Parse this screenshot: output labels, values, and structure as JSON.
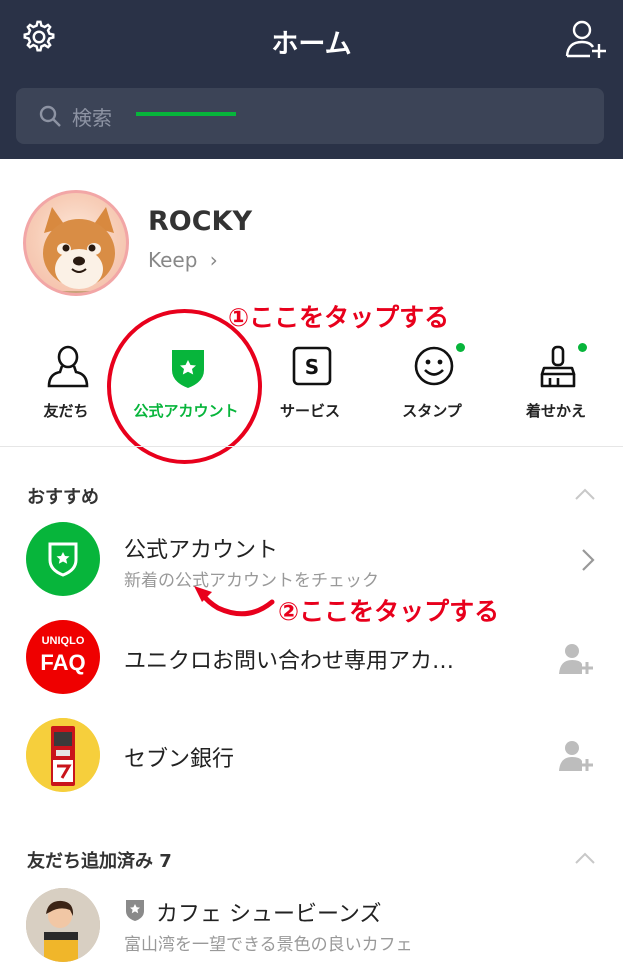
{
  "header": {
    "title": "ホーム",
    "search_placeholder": "検索",
    "icons": [
      "gear-icon",
      "add-friend-icon",
      "search-icon"
    ]
  },
  "profile": {
    "name": "ROCKY",
    "keep_label": "Keep",
    "keep_chevron": "›"
  },
  "tabs": [
    {
      "label": "友だち",
      "icon": "person-icon"
    },
    {
      "label": "公式アカウント",
      "icon": "shield-star-icon",
      "active": true
    },
    {
      "label": "サービス",
      "icon": "service-s-icon"
    },
    {
      "label": "スタンプ",
      "icon": "smiley-icon",
      "badge": true
    },
    {
      "label": "着せかえ",
      "icon": "brush-icon",
      "badge": true
    }
  ],
  "annotations": {
    "step1": "①ここをタップする",
    "step2": "②ここをタップする"
  },
  "recommended": {
    "title": "おすすめ",
    "items": [
      {
        "title": "公式アカウント",
        "subtitle": "新着の公式アカウントをチェック"
      },
      {
        "title": "ユニクロお問い合わせ専用アカ…",
        "logo_top": "UNIQLO",
        "logo_bottom": "FAQ"
      },
      {
        "title": "セブン銀行"
      }
    ]
  },
  "friends_added": {
    "title": "友だち追加済み 7",
    "items": [
      {
        "title": "カフェ シュービーンズ",
        "subtitle": "富山湾を一望できる景色の良いカフェ"
      }
    ]
  },
  "colors": {
    "header_bg": "#2a3247",
    "accent_green": "#07b53b",
    "annotation_red": "#e8001c",
    "uniqlo_red": "#ef0000"
  }
}
